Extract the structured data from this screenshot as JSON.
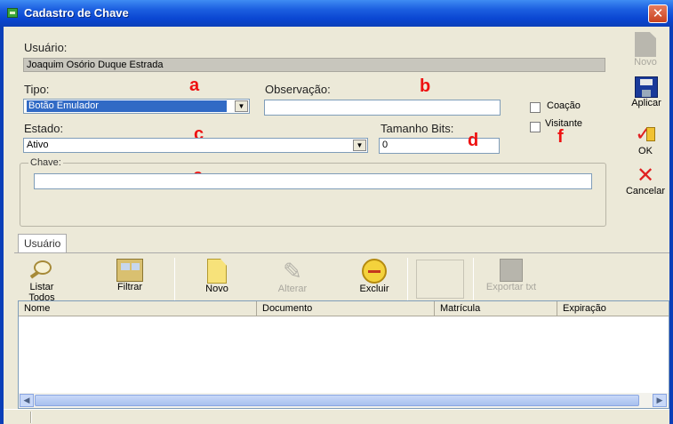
{
  "window": {
    "title": "Cadastro de Chave",
    "close_glyph": "✕"
  },
  "form": {
    "usuario_label": "Usuário:",
    "usuario_value": "Joaquim Osório Duque Estrada",
    "tipo_label": "Tipo:",
    "tipo_value": "Botão Emulador",
    "observacao_label": "Observação:",
    "observacao_value": "",
    "estado_label": "Estado:",
    "estado_value": "Ativo",
    "tamanho_label": "Tamanho Bits:",
    "tamanho_value": "0",
    "coacao_label": "Coação",
    "visitante_label": "Visitante",
    "chave_label": "Chave:",
    "chave_value": ""
  },
  "annotations": {
    "a": "a",
    "b": "b",
    "c": "c",
    "d": "d",
    "e": "e",
    "f": "f"
  },
  "side_toolbar": {
    "novo": "Novo",
    "aplicar": "Aplicar",
    "ok": "OK",
    "cancelar": "Cancelar"
  },
  "tabs": [
    {
      "label": "Usuário"
    }
  ],
  "list_toolbar": {
    "listar_todos": "Listar Todos",
    "filtrar": "Filtrar",
    "novo": "Novo",
    "alterar": "Alterar",
    "excluir": "Excluir",
    "exportar": "Exportar txt"
  },
  "grid": {
    "columns": [
      "Nome",
      "Documento",
      "Matrícula",
      "Expiração"
    ],
    "rows": []
  },
  "colors": {
    "titlebar": "#0a46d2",
    "selection": "#316ac5",
    "annotation": "#e11111"
  }
}
